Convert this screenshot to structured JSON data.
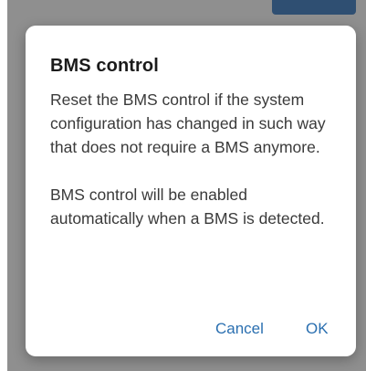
{
  "dialog": {
    "title": "BMS control",
    "paragraphs": [
      "Reset the BMS control if the system configuration has changed in such way that does not require a BMS anymore.",
      "BMS control will be enabled automatically when a BMS is detected."
    ],
    "cancel_label": "Cancel",
    "ok_label": "OK"
  },
  "colors": {
    "accent": "#2a6fb0",
    "scrim": "#8f8f8f",
    "title_text": "#1b1b1b",
    "body_text": "#3a3a3a"
  }
}
